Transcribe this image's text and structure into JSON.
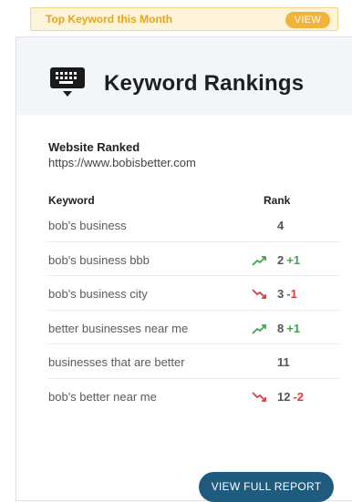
{
  "banner": {
    "title": "Top Keyword this Month",
    "view_label": "VIEW"
  },
  "card": {
    "title": "Keyword Rankings",
    "icon": "keyboard-icon",
    "site_label": "Website Ranked",
    "site_url": "https://www.bobisbetter.com",
    "columns": {
      "keyword": "Keyword",
      "rank": "Rank"
    },
    "rows": [
      {
        "keyword": "bob's business",
        "rank": "4",
        "change": "",
        "trend": "none"
      },
      {
        "keyword": "bob's business bbb",
        "rank": "2",
        "change": "+1",
        "trend": "up"
      },
      {
        "keyword": "bob's business city",
        "rank": "3",
        "change": "-1",
        "trend": "down"
      },
      {
        "keyword": "better businesses near me",
        "rank": "8",
        "change": "+1",
        "trend": "up"
      },
      {
        "keyword": "businesses that are better",
        "rank": "11",
        "change": "",
        "trend": "none"
      },
      {
        "keyword": "bob's better near me",
        "rank": "12",
        "change": "-2",
        "trend": "down"
      }
    ],
    "report_label": "VIEW FULL REPORT"
  },
  "colors": {
    "banner_text": "#e7a51a",
    "banner_button": "#f2b33d",
    "up": "#3aa64c",
    "down": "#e03a3a",
    "report_button": "#1e5b7f"
  }
}
